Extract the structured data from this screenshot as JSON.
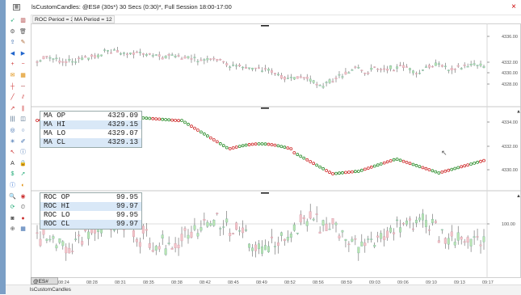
{
  "window": {
    "title": "lsCustomCandles: @ES# (30s*) 30 Secs (0:30)*, Full Session 18:00-17:00",
    "close_glyph": "×",
    "close_color": "#cc0000"
  },
  "params": {
    "roc_period": "ROC Period = 21",
    "ma_period": "MA Period = 12"
  },
  "panels": {
    "price": {
      "y_labels": [
        "4336.00",
        "4332.00",
        "4330.00",
        "4328.00"
      ]
    },
    "ma": {
      "y_labels": [
        "4334.00",
        "4332.00",
        "4330.00"
      ],
      "info": [
        {
          "label": "MA OP",
          "value": "4329.09"
        },
        {
          "label": "MA HI",
          "value": "4329.15"
        },
        {
          "label": "MA LO",
          "value": "4329.07"
        },
        {
          "label": "MA CL",
          "value": "4329.13"
        }
      ]
    },
    "roc": {
      "y_labels": [
        "100.00"
      ],
      "info": [
        {
          "label": "ROC OP",
          "value": "99.95"
        },
        {
          "label": "ROC HI",
          "value": "99.97"
        },
        {
          "label": "ROC LO",
          "value": "99.95"
        },
        {
          "label": "ROC CL",
          "value": "99.97"
        }
      ]
    }
  },
  "time_axis": [
    "08:24",
    "08:28",
    "08:31",
    "08:35",
    "08:38",
    "08:42",
    "08:45",
    "08:49",
    "08:52",
    "08:56",
    "08:59",
    "09:03",
    "09:06",
    "09:10",
    "09:13",
    "09:17"
  ],
  "instrument_tab": "@ES#",
  "status_text": "lsCustomCandles",
  "colors": {
    "up": "#b9e3b0",
    "down": "#f1c3c8",
    "wick": "#444444",
    "ma_dot_red": "#cc2222",
    "ma_dot_green": "#228822",
    "accent": "#7b9fc6"
  },
  "toolbar_icons": [
    "cursor-icon",
    "bar-icon",
    "settings-icon",
    "delete-icon",
    "export-icon",
    "edit-icon",
    "left-arrow-icon",
    "right-arrow-icon",
    "zoom-in-icon",
    "zoom-out-icon",
    "note-icon",
    "calendar-icon",
    "crosshair-icon",
    "hline-icon",
    "trendline-icon",
    "channel-icon",
    "ray-icon",
    "parallel-icon",
    "fib-icon",
    "gann-icon",
    "target-icon",
    "circle-icon",
    "cycles-icon",
    "brush-icon",
    "pointer-icon",
    "info-icon",
    "a-text-icon",
    "lock-icon",
    "trade-icon",
    "arrow-tool-icon",
    "info2-icon",
    "color-icon",
    "search-icon",
    "swatch-icon",
    "refresh-icon",
    "clock-icon",
    "camera-icon",
    "record-icon",
    "snap-icon",
    "grid-icon"
  ]
}
